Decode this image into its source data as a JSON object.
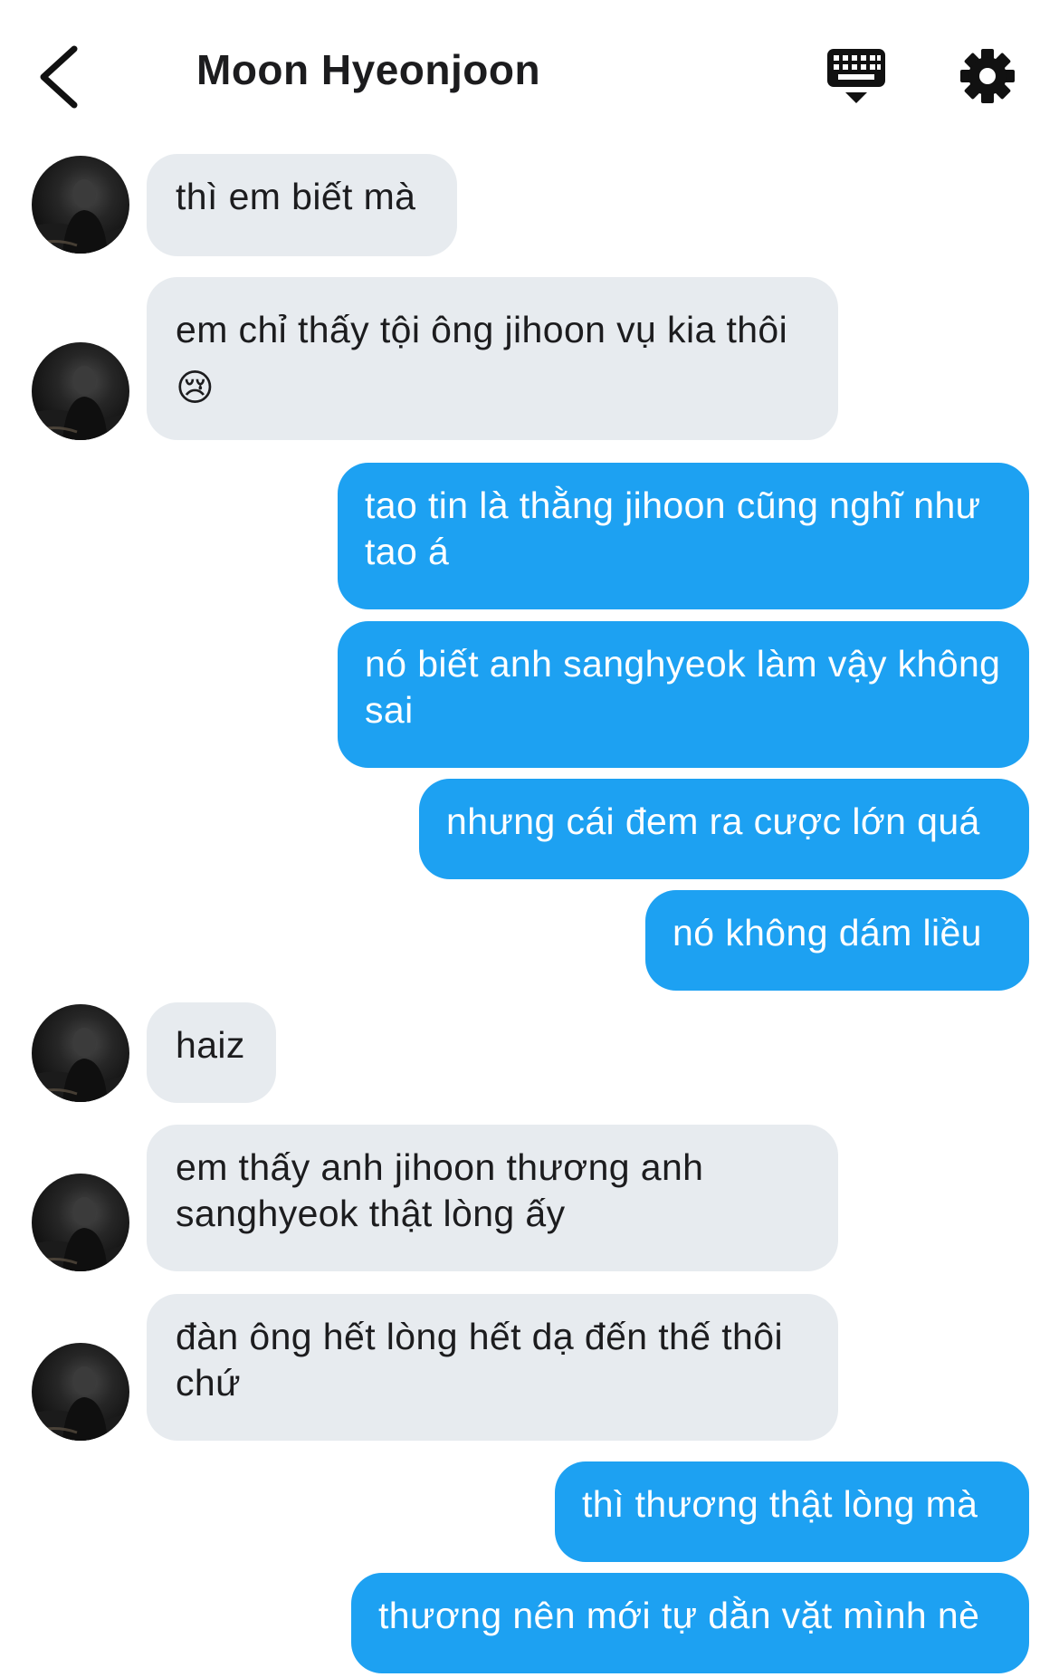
{
  "header": {
    "title": "Moon Hyeonjoon"
  },
  "icons": {
    "back": "chevron-left-icon",
    "keyboard": "keyboard-icon",
    "settings": "gear-icon"
  },
  "colors": {
    "outgoing_bubble": "#1da1f2",
    "incoming_bubble": "#e7ebef",
    "text_dark": "#1c1c1e"
  },
  "messages": [
    {
      "side": "incoming",
      "text": "thì em biết mà"
    },
    {
      "side": "incoming",
      "text": "em chỉ thấy tội ông jihoon vụ kia thôi 😢"
    },
    {
      "side": "outgoing",
      "text": "tao tin là thằng jihoon cũng nghĩ như tao á"
    },
    {
      "side": "outgoing",
      "text": "nó biết anh sanghyeok làm vậy không sai"
    },
    {
      "side": "outgoing",
      "text": "nhưng cái đem ra cược lớn quá"
    },
    {
      "side": "outgoing",
      "text": "nó không dám liều"
    },
    {
      "side": "incoming",
      "text": "haiz"
    },
    {
      "side": "incoming",
      "text": "em thấy anh jihoon thương anh sanghyeok thật lòng ấy"
    },
    {
      "side": "incoming",
      "text": "đàn ông hết lòng hết dạ đến thế thôi chứ"
    },
    {
      "side": "outgoing",
      "text": "thì thương thật lòng mà"
    },
    {
      "side": "outgoing",
      "text": "thương nên mới tự dằn vặt mình nè"
    }
  ]
}
